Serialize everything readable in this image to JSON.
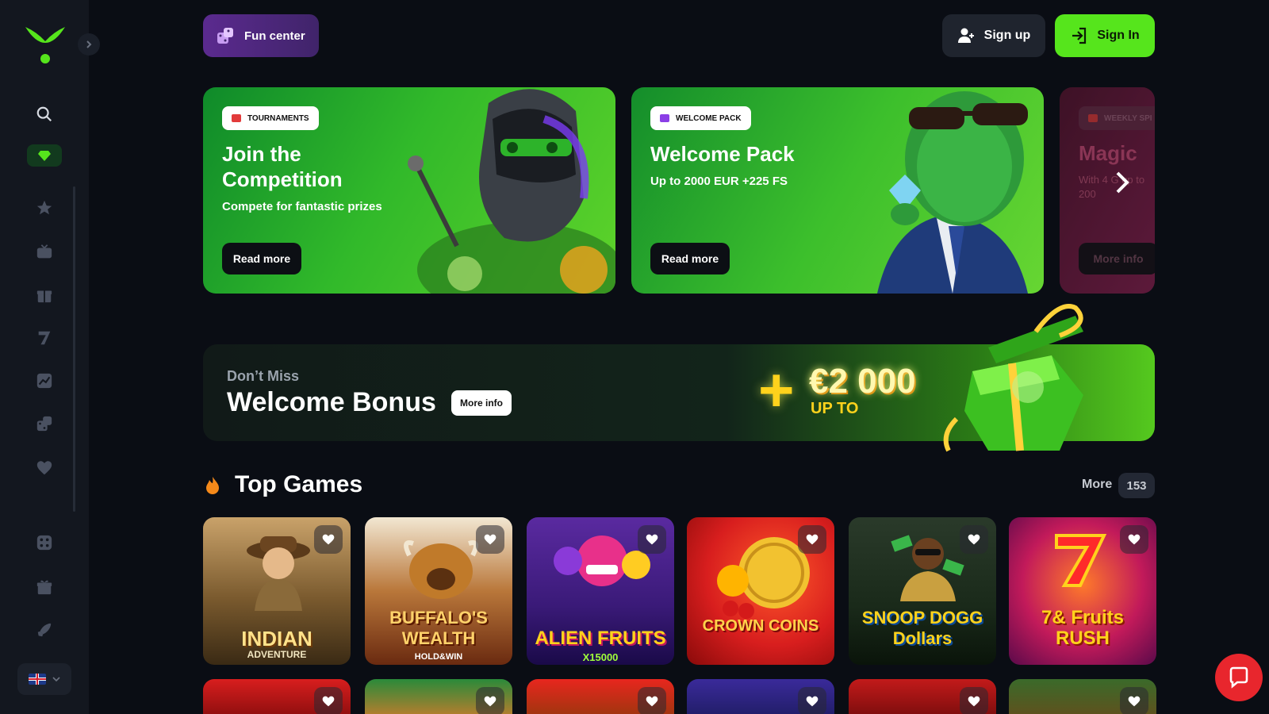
{
  "header": {
    "fun_center": "Fun center",
    "sign_up": "Sign up",
    "sign_in": "Sign In"
  },
  "promos": [
    {
      "tag": "TOURNAMENTS",
      "title": "Join the Competition",
      "subtitle": "Compete for fantastic prizes",
      "button": "Read more"
    },
    {
      "tag": "WELCOME PACK",
      "title": "Welcome Pack",
      "subtitle": "Up to 2000 EUR +225 FS",
      "button": "Read more"
    },
    {
      "tag": "WEEKLY SPI",
      "title": "Magic",
      "subtitle": "With 4 G up to 200",
      "button": "More info"
    }
  ],
  "bonus": {
    "eyebrow": "Don’t Miss",
    "title": "Welcome Bonus",
    "button": "More info",
    "plus": "+",
    "amount": "€2 000",
    "up_to": "UP TO"
  },
  "top_games": {
    "title": "Top Games",
    "more_label": "More",
    "count": "153",
    "games": [
      {
        "name": "INDIAN",
        "sub": "ADVENTURE"
      },
      {
        "name": "BUFFALO'S WEALTH",
        "sub": "HOLD&WIN"
      },
      {
        "name": "ALIEN FRUITS",
        "sub": "X15000"
      },
      {
        "name": "CROWN COINS",
        "sub": ""
      },
      {
        "name": "SNOOP DOGG Dollars",
        "sub": ""
      },
      {
        "name": "7& Fruits RUSH",
        "sub": ""
      }
    ]
  },
  "colors": {
    "accent": "#56e51c",
    "background": "#0a0d14",
    "sidebar": "#13171f",
    "chat": "#e8262d"
  },
  "icons": [
    "search-icon",
    "gem-icon",
    "star-icon",
    "tv-icon",
    "gift-box-icon",
    "seven-icon",
    "chart-icon",
    "dice-icon",
    "heart-icon",
    "dice-face-icon",
    "gift-icon",
    "rocket-icon"
  ]
}
